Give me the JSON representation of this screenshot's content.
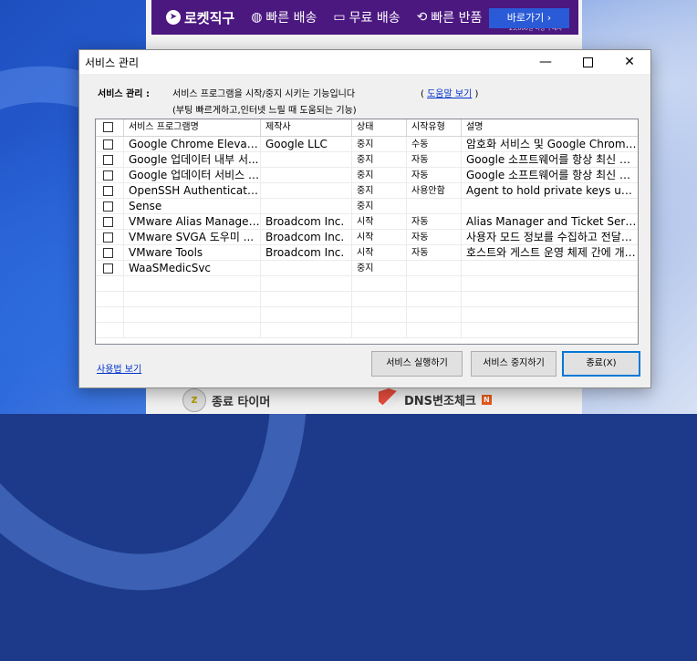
{
  "banner": {
    "logo": "로켓직구",
    "item1": "빠른 배송",
    "item2": "무료 배송",
    "item2_note": "25,000원 이상 구매시",
    "item3": "빠른 반품",
    "goto": "바로가기 ›"
  },
  "bottom": {
    "timer": "종료 타이머",
    "dns": "DNS변조체크",
    "new_badge": "N"
  },
  "dialog": {
    "title": "서비스 관리",
    "window_controls": {
      "minimize": "—",
      "close": "✕"
    },
    "desc_label": "서비스 관리 :",
    "desc_line1": "서비스 프로그램을 시작/중지 시키는 기능입니다",
    "desc_line2": "(부팅 빠르게하고,인터넷 느릴 때 도움되는 기능)",
    "help_open": "(",
    "help_link": "도움말 보기",
    "help_close": ")",
    "columns": [
      "서비스 프로그램명",
      "제작사",
      "상태",
      "시작유형",
      "설명"
    ],
    "rows": [
      {
        "name": "Google Chrome Elevati...",
        "vendor": "Google LLC",
        "status": "중지",
        "start": "수동",
        "desc": "암호화 서비스 및 Google Chrome ..."
      },
      {
        "name": "Google 업데이터 내부 서...",
        "vendor": "",
        "status": "중지",
        "start": "자동",
        "desc": "Google 소프트웨어를 항상 최신 상..."
      },
      {
        "name": "Google 업데이터 서비스 (...",
        "vendor": "",
        "status": "중지",
        "start": "자동",
        "desc": "Google 소프트웨어를 항상 최신 상..."
      },
      {
        "name": "OpenSSH Authenticati...",
        "vendor": "",
        "status": "중지",
        "start": "사용안함",
        "desc": "Agent to hold private keys use..."
      },
      {
        "name": "Sense",
        "vendor": "",
        "status": "중지",
        "start": "",
        "desc": ""
      },
      {
        "name": "VMware Alias Manager ...",
        "vendor": "Broadcom Inc.",
        "status": "시작",
        "start": "자동",
        "desc": "Alias Manager and Ticket Service"
      },
      {
        "name": "VMware SVGA 도우미 ...",
        "vendor": "Broadcom Inc.",
        "status": "시작",
        "start": "자동",
        "desc": "사용자 모드 정보를 수집하고 전달하..."
      },
      {
        "name": "VMware Tools",
        "vendor": "Broadcom Inc.",
        "status": "시작",
        "start": "자동",
        "desc": "호스트와 게스트 운영 체제 간에 개체..."
      },
      {
        "name": "WaaSMedicSvc",
        "vendor": "",
        "status": "중지",
        "start": "",
        "desc": ""
      }
    ],
    "usage_link": "사용법 보기",
    "btn_run": "서비스 실행하기",
    "btn_stop": "서비스 중지하기",
    "btn_close": "종료(X)"
  }
}
